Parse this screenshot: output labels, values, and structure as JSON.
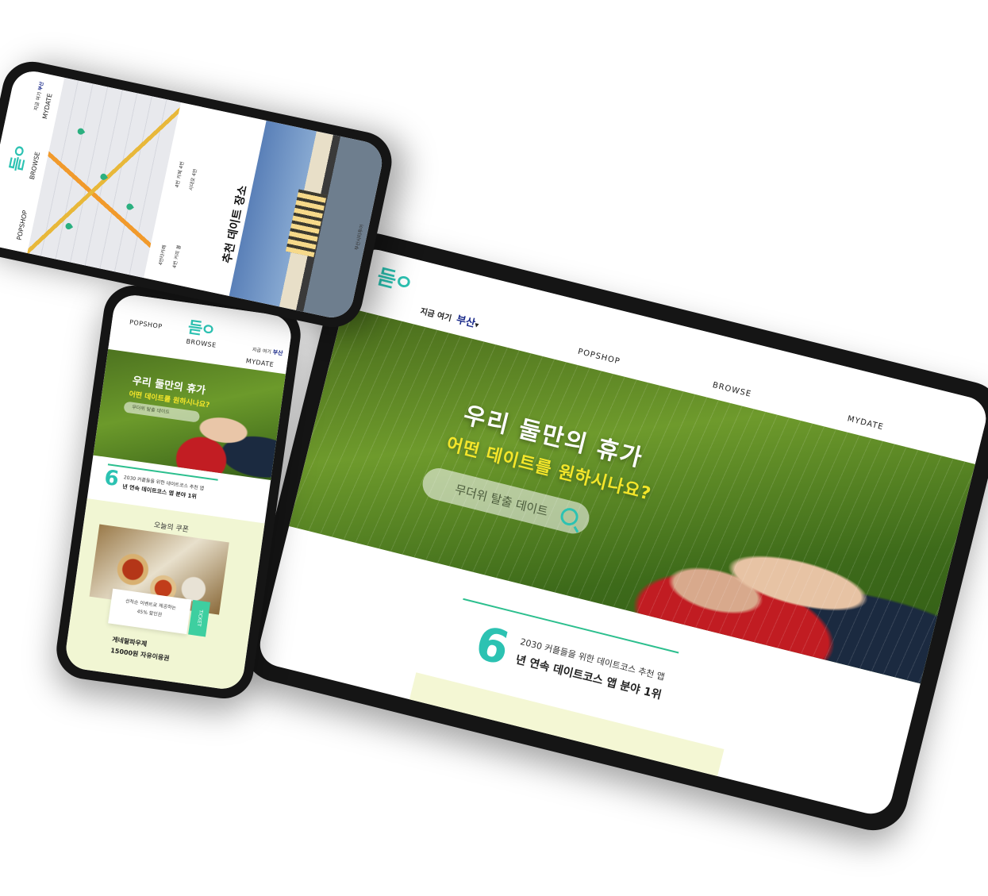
{
  "tablet": {
    "logo": "듣ㅇ",
    "location_prefix": "지금 여기",
    "location_city": "부산",
    "menu": [
      "POPSHOP",
      "BROWSE",
      "MYDATE"
    ],
    "hero_title": "우리 둘만의 휴가",
    "hero_subtitle": "어떤 데이트를 원하시나요?",
    "search_placeholder": "무더위 탈출 데이트",
    "stat_number": "6",
    "stat_line1": "2030 커플들을 위한 데이트코스 추천 앱",
    "stat_line2": "년 연속 데이트코스 앱 분야 1위"
  },
  "phone_home": {
    "logo": "듣ㅇ",
    "menu": [
      "POPSHOP",
      "BROWSE",
      "MYDATE"
    ],
    "location_prefix": "지금 여기",
    "location_city": "부산",
    "hero_title": "우리 둘만의 휴가",
    "hero_subtitle": "어떤 데이트를 원하시나요?",
    "search_placeholder": "무더위 탈출 데이트",
    "stat_number": "6",
    "stat_line1": "2030 커플들을 위한 데이트코스 추천 앱",
    "stat_line2": "년 연속 데이트코스 앱 분야 1위",
    "coupon_title": "오늘의 쿠폰",
    "coupon_desc_1": "선착순 이벤트로 제공하는",
    "coupon_desc_2": "45% 할인권",
    "coupon_ticket": "TICKET",
    "coupon_name": "게네랄파우제",
    "coupon_price": "15000원 자유이용권"
  },
  "phone_map": {
    "logo": "듣ㅇ",
    "menu": [
      "POPSHOP",
      "BROWSE",
      "MYDATE"
    ],
    "location_prefix": "지금 여기",
    "location_city": "부산",
    "place_list": [
      "4번타카페",
      "4번 커피 볼",
      "4번 카페 4번",
      "시대로 4번"
    ],
    "section_title": "추천 데이트 장소",
    "footer": "부산시티투어"
  },
  "colors": {
    "accent": "#2cc2b2",
    "highlight": "#f4e62a",
    "divider": "#2cbf8e",
    "coupon_bg": "#f1f6d3"
  }
}
